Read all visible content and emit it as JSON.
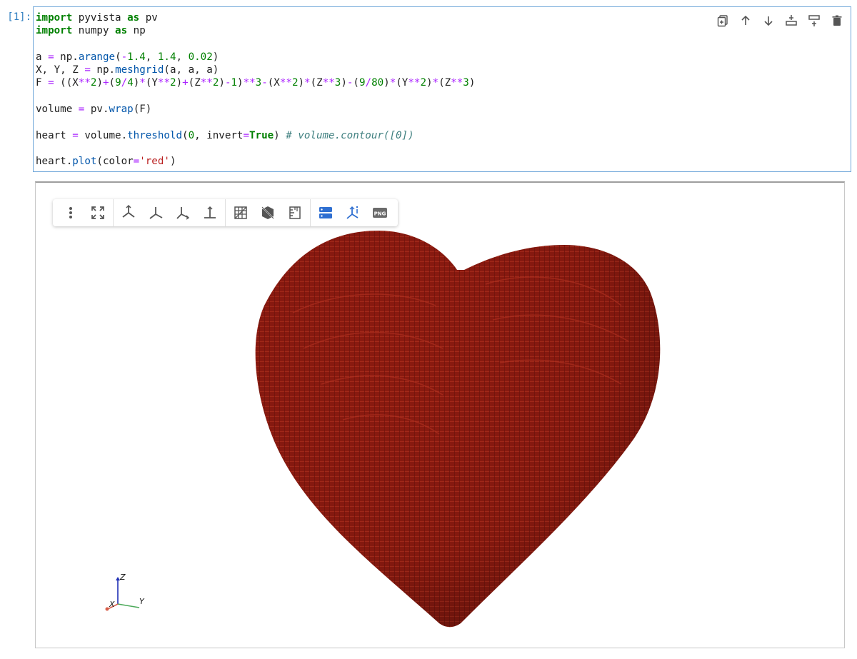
{
  "cell": {
    "prompt": "[1]:",
    "code_lines": [
      "import pyvista as pv",
      "import numpy as np",
      "",
      "a = np.arange(-1.4, 1.4, 0.02)",
      "X, Y, Z = np.meshgrid(a, a, a)",
      "F = ((X**2)+(9/4)*(Y**2)+(Z**2)-1)**3-(X**2)*(Z**3)-(9/80)*(Y**2)*(Z**3)",
      "",
      "volume = pv.wrap(F)",
      "",
      "heart = volume.threshold(0, invert=True) # volume.contour([0])",
      "",
      "heart.plot(color='red')"
    ],
    "toolbar_icons": [
      "duplicate-icon",
      "move-up-icon",
      "move-down-icon",
      "insert-above-icon",
      "insert-below-icon",
      "delete-icon"
    ]
  },
  "viewer": {
    "toolbar_icons": [
      "menu-dots-icon",
      "fullscreen-icon",
      "view-isometric-icon",
      "view-xy-icon",
      "view-xz-icon",
      "view-yz-icon",
      "toggle-grid-icon",
      "toggle-parallel-icon",
      "ruler-icon",
      "server-rendering-icon",
      "axes-widget-icon",
      "png-screenshot-icon"
    ],
    "png_label": "PNG",
    "mesh_color": "#8b1a10",
    "axes": {
      "x": "X",
      "y": "Y",
      "z": "Z"
    }
  }
}
